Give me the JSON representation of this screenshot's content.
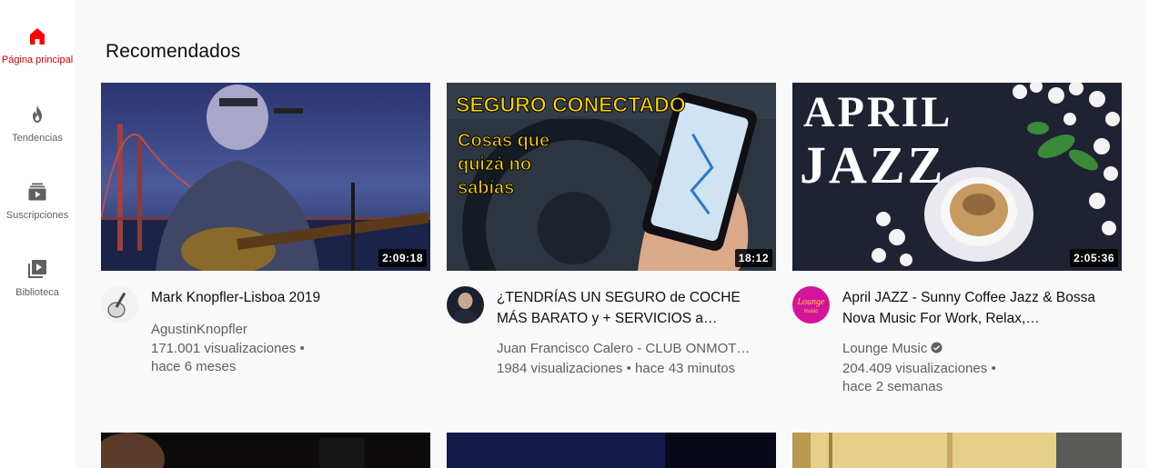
{
  "sidebar": {
    "items": [
      {
        "label": "Página principal",
        "icon": "home-icon",
        "active": true
      },
      {
        "label": "Tendencias",
        "icon": "fire-icon",
        "active": false
      },
      {
        "label": "Suscripciones",
        "icon": "subscriptions-icon",
        "active": false
      },
      {
        "label": "Biblioteca",
        "icon": "library-icon",
        "active": false
      }
    ]
  },
  "main": {
    "section_title": "Recomendados",
    "videos": [
      {
        "title": "Mark Knopfler-Lisboa 2019",
        "channel": "AgustinKnopfler",
        "views": "171.001 visualizaciones •",
        "age": "hace 6 meses",
        "duration": "2:09:18",
        "verified": false
      },
      {
        "title": "¿TENDRÍAS UN SEGURO de COCHE MÁS BARATO y + SERVICIOS a…",
        "channel": "Juan Francisco Calero - CLUB ONMOT…",
        "views": "1984 visualizaciones • hace 43 minutos",
        "age": "",
        "duration": "18:12",
        "verified": false,
        "thumb_text": {
          "line1": "SEGURO CONECTADO",
          "line2": "Cosas que",
          "line3": "quizá no",
          "line4": "sabías"
        }
      },
      {
        "title": "April JAZZ - Sunny Coffee Jazz & Bossa Nova Music For Work, Relax,…",
        "channel": "Lounge Music",
        "views": "204.409 visualizaciones •",
        "age": "hace 2 semanas",
        "duration": "2:05:36",
        "verified": true,
        "thumb_text": {
          "line1": "APRIL",
          "line2": "JAZZ"
        },
        "avatar_text": "Lounge music"
      }
    ]
  },
  "colors": {
    "accent": "#ff0000",
    "active_label": "#cc0000",
    "background": "#f9f9f9",
    "secondary_text": "#606060"
  }
}
